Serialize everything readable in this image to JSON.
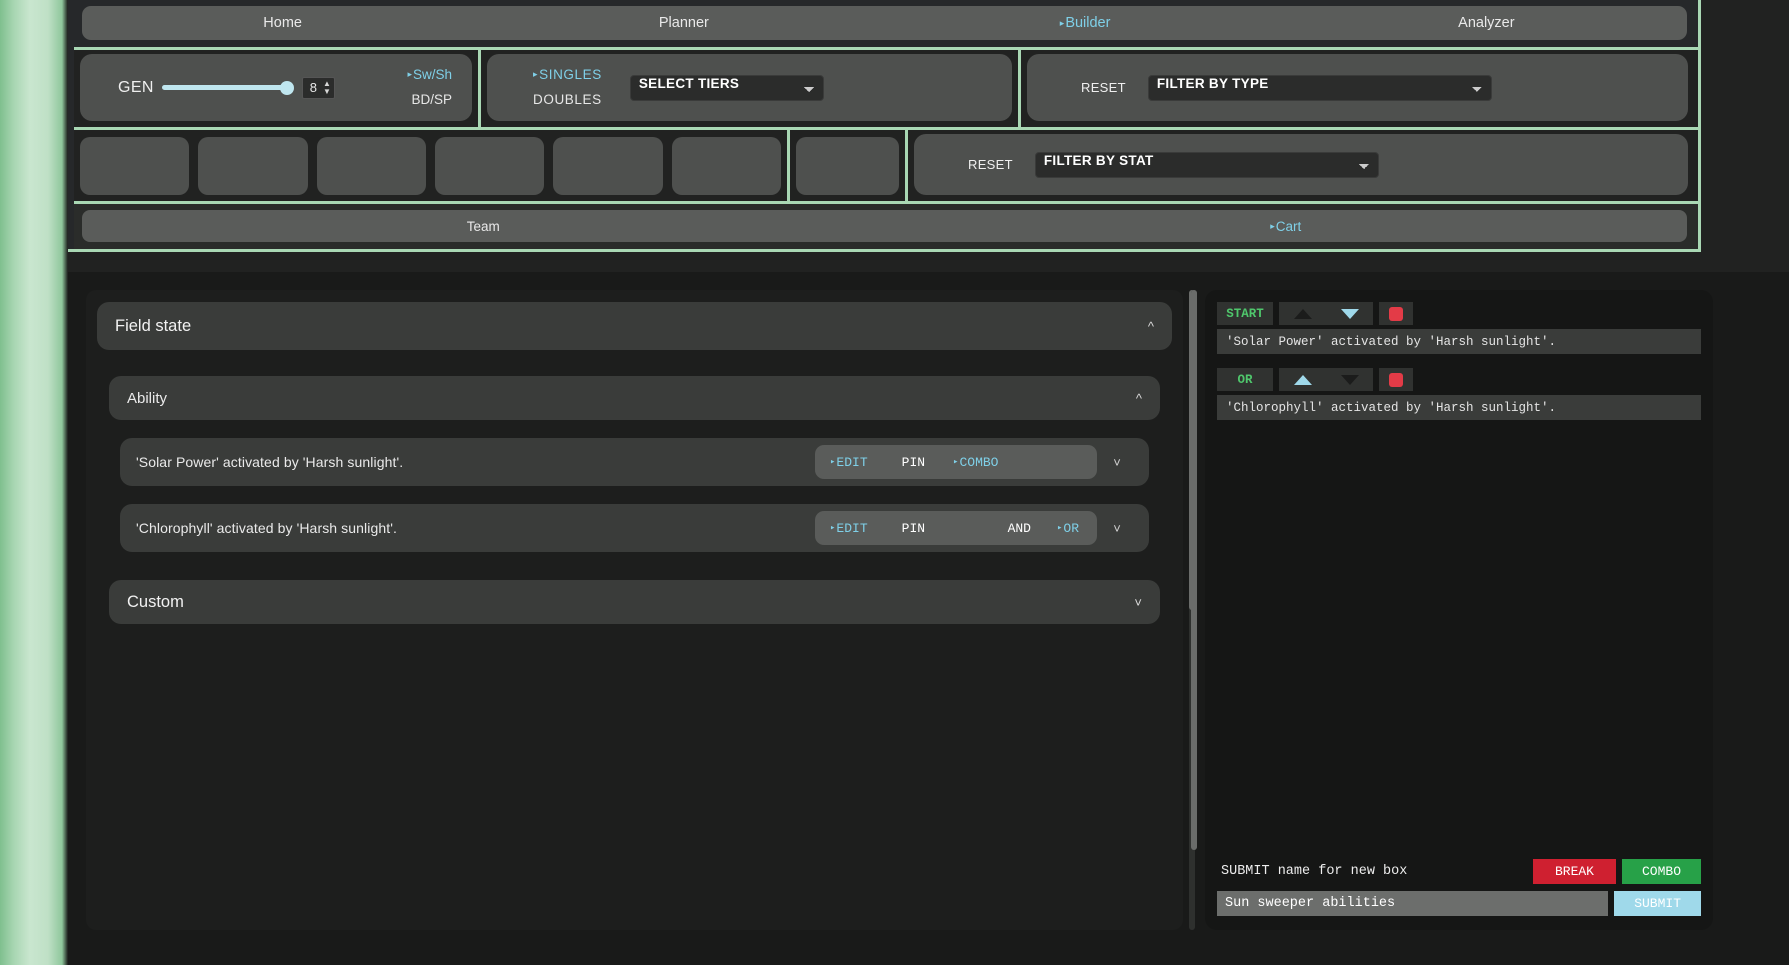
{
  "nav": {
    "items": [
      {
        "label": "Home",
        "active": false
      },
      {
        "label": "Planner",
        "active": false
      },
      {
        "label": "Builder",
        "active": true
      },
      {
        "label": "Analyzer",
        "active": false
      }
    ]
  },
  "gen": {
    "label": "GEN",
    "value": "8",
    "options": [
      {
        "label": "Sw/Sh",
        "selected": true
      },
      {
        "label": "BD/SP",
        "selected": false
      }
    ]
  },
  "format": {
    "options": [
      {
        "label": "SINGLES",
        "selected": true
      },
      {
        "label": "DOUBLES",
        "selected": false
      }
    ],
    "tiers_select": "SELECT TIERS"
  },
  "filters": {
    "type": {
      "reset_label": "RESET",
      "select_value": "FILTER BY TYPE"
    },
    "stat": {
      "reset_label": "RESET",
      "select_value": "FILTER BY STAT"
    }
  },
  "team_slots": [
    "",
    "",
    "",
    "",
    "",
    ""
  ],
  "extra_slot": "",
  "team_tabs": [
    {
      "label": "Team",
      "active": false
    },
    {
      "label": "Cart",
      "active": true
    }
  ],
  "main": {
    "field_state_title": "Field state",
    "ability_section_title": "Ability",
    "custom_section_title": "Custom",
    "ability_rows": [
      {
        "text": "'Solar Power' activated by 'Harsh sunlight'.",
        "edit": "EDIT",
        "pin": "PIN",
        "combo": "COMBO",
        "and": "",
        "or": ""
      },
      {
        "text": "'Chlorophyll' activated by 'Harsh sunlight'.",
        "edit": "EDIT",
        "pin": "PIN",
        "combo": "",
        "and": "AND",
        "or": "OR"
      }
    ]
  },
  "cart": {
    "cards": [
      {
        "tag": "START",
        "up_enabled": false,
        "down_enabled": true,
        "text": "'Solar Power' activated by 'Harsh sunlight'."
      },
      {
        "tag": "OR",
        "up_enabled": true,
        "down_enabled": false,
        "text": "'Chlorophyll' activated by 'Harsh sunlight'."
      }
    ],
    "submit_hint": "SUBMIT name for new box",
    "break_label": "BREAK",
    "combo_label": "COMBO",
    "name_value": "Sun sweeper abilities",
    "name_placeholder": "",
    "submit_label": "SUBMIT"
  },
  "colors": {
    "accent_green": "#a9d8b4",
    "link_blue": "#7fd0e8",
    "start_green": "#4fc76c",
    "break_red": "#cf2030",
    "combo_green": "#27a148",
    "submit_blue": "#9fd9ea"
  }
}
